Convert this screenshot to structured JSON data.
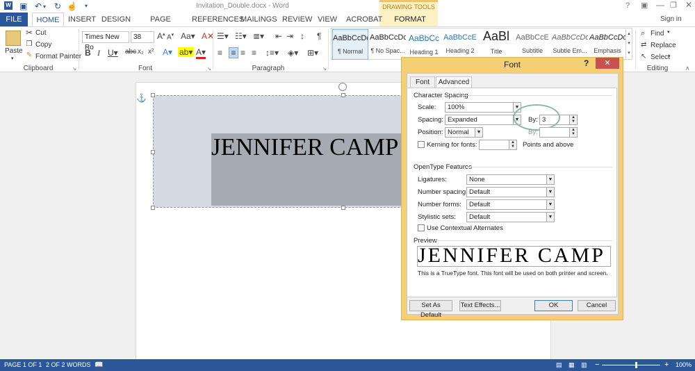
{
  "window": {
    "title": "Invitation_Double.docx - Word",
    "help": "?",
    "signin": "Sign in",
    "drawing_tools": "DRAWING TOOLS"
  },
  "tabs": [
    "FILE",
    "HOME",
    "INSERT",
    "DESIGN",
    "PAGE LAYOUT",
    "REFERENCES",
    "MAILINGS",
    "REVIEW",
    "VIEW",
    "ACROBAT",
    "FORMAT"
  ],
  "clipboard": {
    "paste": "Paste",
    "cut": "Cut",
    "copy": "Copy",
    "format_painter": "Format Painter",
    "label": "Clipboard"
  },
  "font": {
    "name": "Times New Ro",
    "size": "38",
    "label": "Font"
  },
  "paragraph": {
    "label": "Paragraph"
  },
  "styles": [
    {
      "sample": "AaBbCcDc",
      "name": "¶ Normal"
    },
    {
      "sample": "AaBbCcDc",
      "name": "¶ No Spac..."
    },
    {
      "sample": "AaBbCc",
      "name": "Heading 1"
    },
    {
      "sample": "AaBbCcE",
      "name": "Heading 2"
    },
    {
      "sample": "AaBl",
      "name": "Title"
    },
    {
      "sample": "AaBbCcE",
      "name": "Subtitle"
    },
    {
      "sample": "AaBbCcDc",
      "name": "Subtle Em..."
    },
    {
      "sample": "AaBbCcDc",
      "name": "Emphasis"
    }
  ],
  "editing": {
    "find": "Find",
    "replace": "Replace",
    "select": "Select",
    "label": "Editing"
  },
  "document": {
    "text": "JENNIFER CAMP"
  },
  "status": {
    "page": "PAGE 1 OF 1",
    "words": "2 OF 2 WORDS",
    "zoom": "100%",
    "minus": "−",
    "plus": "+"
  },
  "dialog": {
    "title": "Font",
    "tab_font": "Font",
    "tab_advanced": "Advanced",
    "char_spacing": "Character Spacing",
    "scale_label": "Scale:",
    "scale_value": "100%",
    "spacing_label": "Spacing:",
    "spacing_value": "Expanded",
    "by_label": "By:",
    "by_value": "3",
    "position_label": "Position:",
    "position_value": "Normal",
    "by2_label": "By:",
    "kerning_label": "Kerning for fonts:",
    "points_above": "Points and above",
    "opentype": "OpenType Features",
    "ligatures_label": "Ligatures:",
    "ligatures_value": "None",
    "numspacing_label": "Number spacing:",
    "numspacing_value": "Default",
    "numforms_label": "Number forms:",
    "numforms_value": "Default",
    "stylistic_label": "Stylistic sets:",
    "stylistic_value": "Default",
    "contextual": "Use Contextual Alternates",
    "preview_label": "Preview",
    "preview_text": "JENNIFER CAMP",
    "truetype_note": "This is a TrueType font. This font will be used on both printer and screen.",
    "set_default": "Set As Default",
    "text_effects": "Text Effects...",
    "ok": "OK",
    "cancel": "Cancel"
  }
}
